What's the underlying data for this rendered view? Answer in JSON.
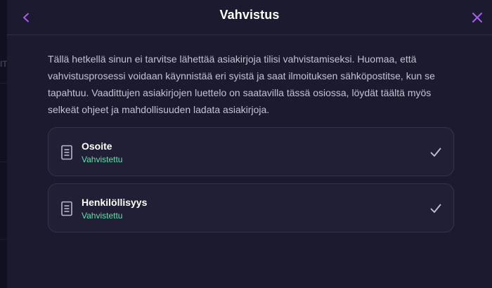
{
  "header": {
    "title": "Vahvistus",
    "back_icon": "chevron-left-icon",
    "close_icon": "close-icon"
  },
  "intro_text": "Tällä hetkellä sinun ei tarvitse lähettää asiakirjoja tilisi vahvistamiseksi. Huomaa, että vahvistusprosessi voidaan käynnistää eri syistä ja saat ilmoituksen sähköpostitse, kun se tapahtuu. Vaadittujen asiakirjojen luettelo on saatavilla tässä osiossa, löydät täältä myös selkeät ohjeet ja mahdollisuuden ladata asiakirjoja.",
  "documents": [
    {
      "title": "Osoite",
      "status": "Vahvistettu",
      "icon": "document-icon",
      "status_icon": "checkmark-icon"
    },
    {
      "title": "Henkilöllisyys",
      "status": "Vahvistettu",
      "icon": "document-icon",
      "status_icon": "checkmark-icon"
    }
  ],
  "colors": {
    "accent": "#a55cf0",
    "background": "#1b1a2e",
    "card": "#201f35",
    "status_verified": "#5ee0a8"
  }
}
